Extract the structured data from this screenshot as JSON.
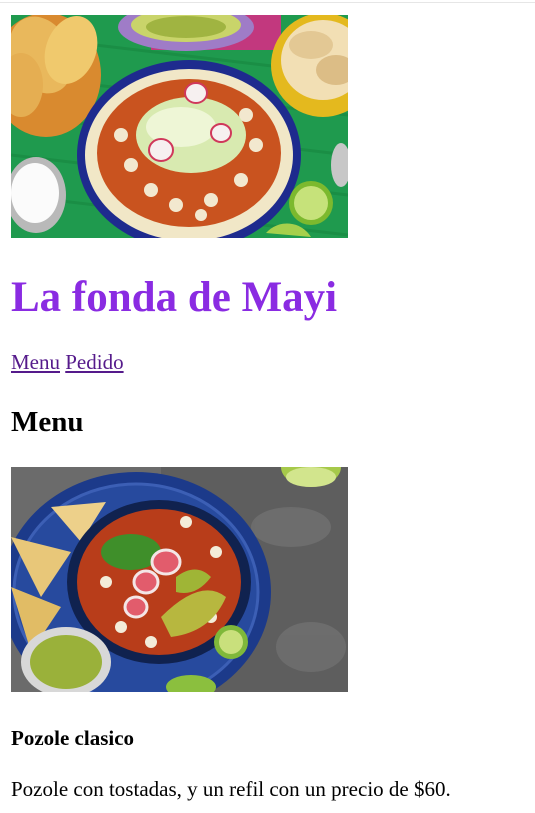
{
  "site": {
    "title": "La fonda de Mayi",
    "title_color": "#8a2be2",
    "link_color": "#551a8b"
  },
  "nav": {
    "items": [
      {
        "label": "Menu"
      },
      {
        "label": "Pedido"
      }
    ]
  },
  "menu": {
    "heading": "Menu",
    "dishes": [
      {
        "name": "Pozole clasico",
        "description": "Pozole con tostadas, y un refil con un precio de $60."
      }
    ]
  },
  "images": {
    "hero_icon": "pozole-table-photo",
    "dish_icon": "pozole-bowl-photo"
  }
}
